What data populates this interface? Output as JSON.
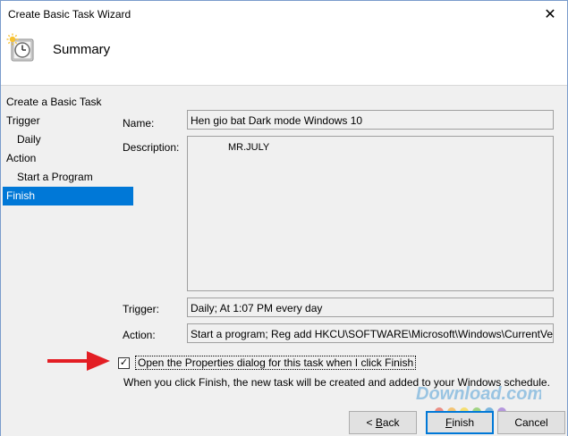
{
  "window": {
    "title": "Create Basic Task Wizard",
    "close_glyph": "✕"
  },
  "header": {
    "heading": "Summary",
    "icon": "task-scheduler-clock-icon"
  },
  "steps": [
    {
      "label": "Create a Basic Task",
      "level": 0,
      "active": false
    },
    {
      "label": "Trigger",
      "level": 0,
      "active": false
    },
    {
      "label": "Daily",
      "level": 1,
      "active": false
    },
    {
      "label": "Action",
      "level": 0,
      "active": false
    },
    {
      "label": "Start a Program",
      "level": 1,
      "active": false
    },
    {
      "label": "Finish",
      "level": 0,
      "active": true
    }
  ],
  "summary": {
    "name_label": "Name:",
    "name_value": "Hen gio bat Dark mode Windows 10",
    "description_label": "Description:",
    "description_value": "MR.JULY",
    "trigger_label": "Trigger:",
    "trigger_value": "Daily; At 1:07 PM every day",
    "action_label": "Action:",
    "action_value": "Start a program; Reg add HKCU\\SOFTWARE\\Microsoft\\Windows\\CurrentVers"
  },
  "open_properties": {
    "label": "Open the Properties dialog for this task when I click Finish",
    "checked": true,
    "check_glyph": "✓"
  },
  "info_text": "When you click Finish, the new task will be created and added to your Windows schedule.",
  "watermark": {
    "text": "Download.com.vn"
  },
  "buttons": {
    "back_prefix": "< ",
    "back_mnemonic": "B",
    "back_rest": "ack",
    "finish_mnemonic": "F",
    "finish_rest": "inish",
    "cancel": "Cancel"
  },
  "colors": {
    "accent": "#0078d7",
    "arrow": "#e31e24"
  }
}
